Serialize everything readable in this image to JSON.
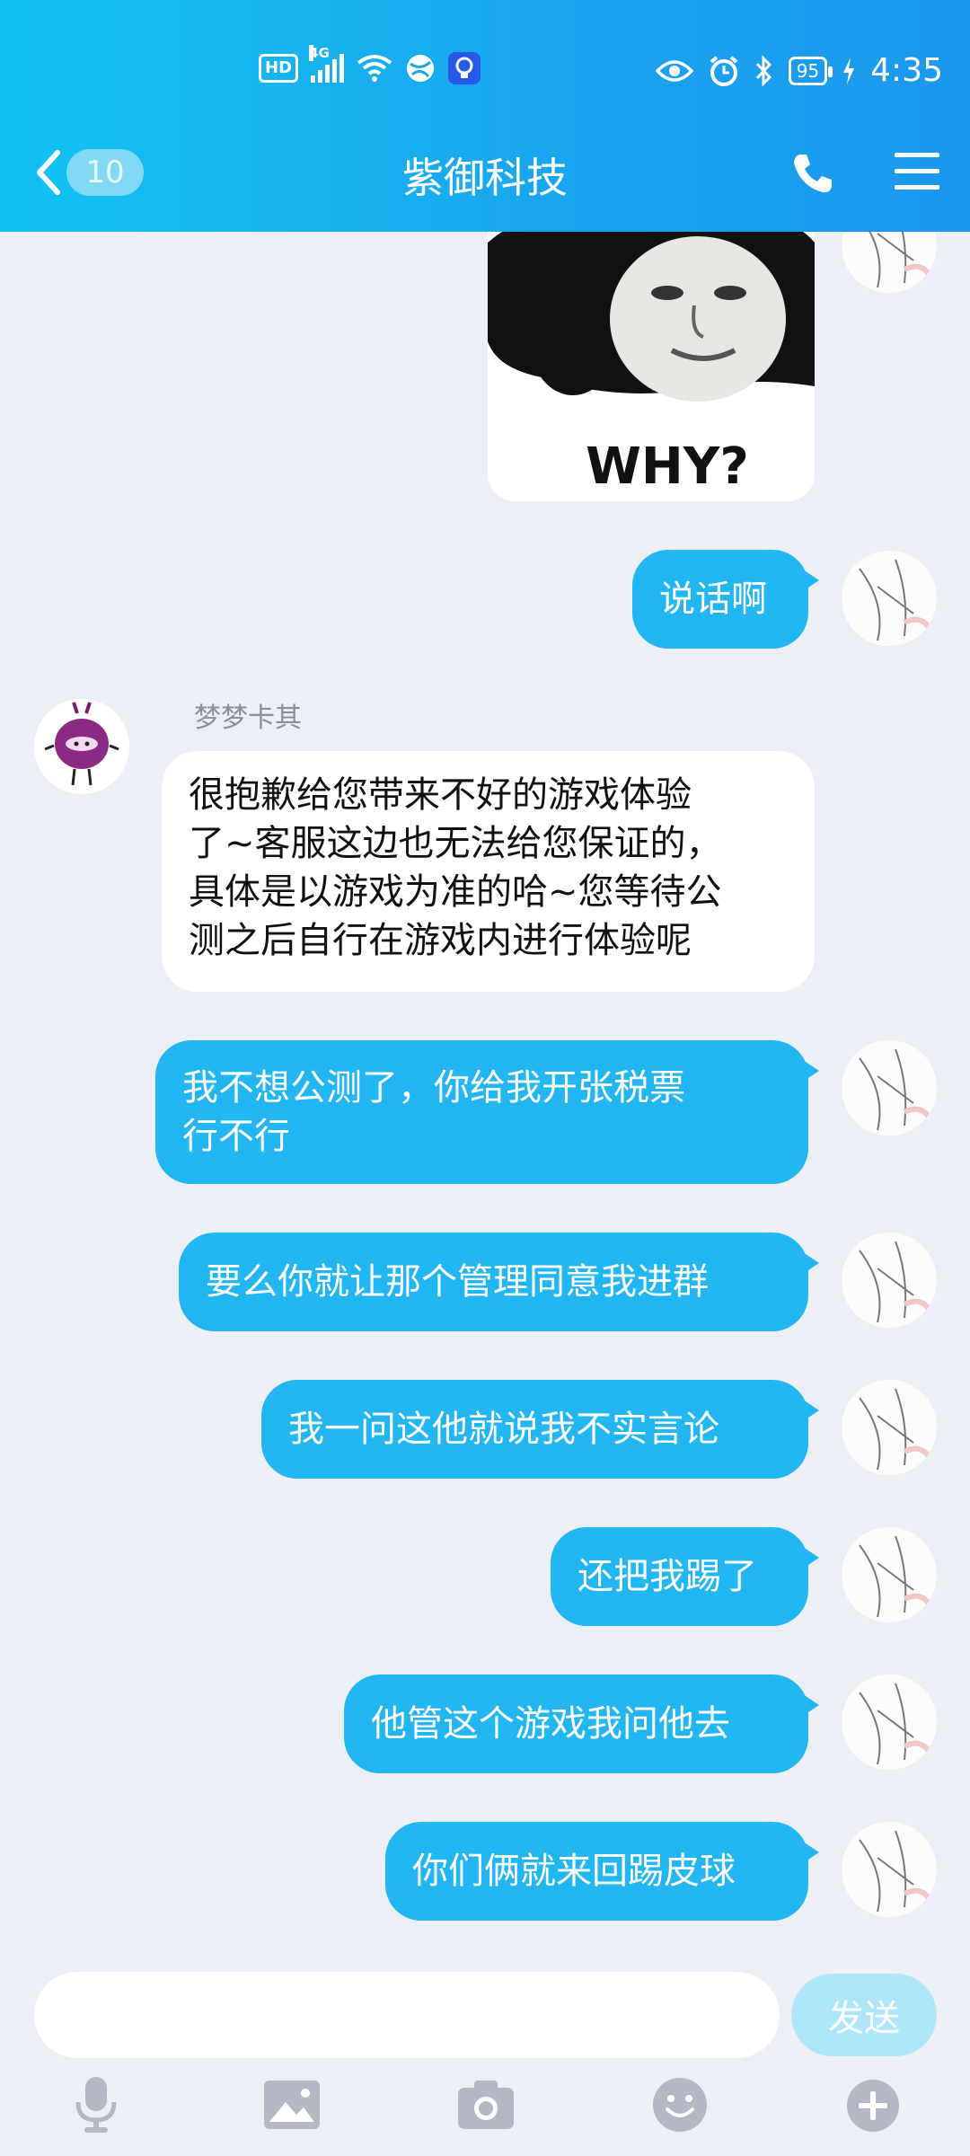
{
  "status_bar": {
    "hd_badge": "HD",
    "network_type": "4G",
    "battery_level": "95",
    "time": "4:35"
  },
  "header": {
    "back_count": "10",
    "title": "紫御科技"
  },
  "conversation": {
    "sticker_caption": "WHY?",
    "sender_name": "梦梦卡其",
    "messages": [
      {
        "from": "me",
        "text": "说话啊"
      },
      {
        "from": "other",
        "lines": [
          "很抱歉给您带来不好的游戏体验",
          "了~客服这边也无法给您保证的，",
          "具体是以游戏为准的哈~您等待公",
          "测之后自行在游戏内进行体验呢"
        ]
      },
      {
        "from": "me",
        "lines": [
          "我不想公测了，你给我开张税票",
          "行不行"
        ]
      },
      {
        "from": "me",
        "text": "要么你就让那个管理同意我进群"
      },
      {
        "from": "me",
        "text": "我一问这他就说我不实言论"
      },
      {
        "from": "me",
        "text": "还把我踢了"
      },
      {
        "from": "me",
        "text": "他管这个游戏我问他去"
      },
      {
        "from": "me",
        "text": "你们俩就来回踢皮球"
      }
    ]
  },
  "input": {
    "send_label": "发送"
  },
  "toolbar": {
    "icons": [
      "microphone-icon",
      "image-icon",
      "camera-icon",
      "emoji-icon",
      "plus-icon"
    ]
  },
  "colors": {
    "header_gradient_start": "#12c3f2",
    "header_gradient_end": "#1b97ee",
    "outgoing_bubble": "#22b6f2",
    "incoming_bubble": "#ffffff",
    "chat_background": "#eceff6",
    "send_button_disabled": "#aee6fa",
    "toolbar_icon": "#b3b8c4"
  }
}
